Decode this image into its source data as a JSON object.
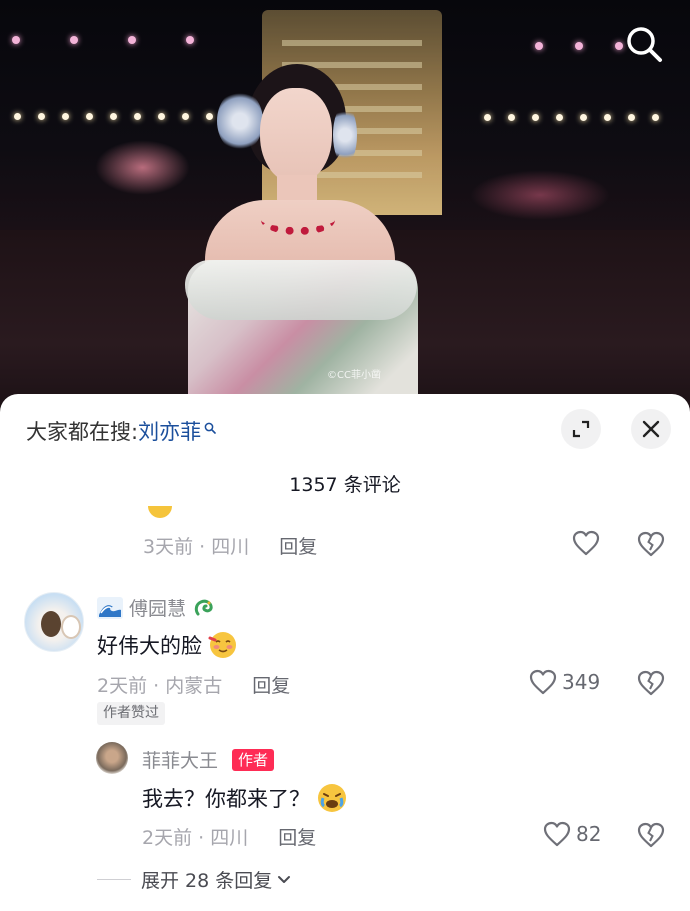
{
  "video": {
    "watermark": "©CC菲小凿"
  },
  "sheet": {
    "hot_search_prefix": "大家都在搜:",
    "hot_search_keyword": "刘亦菲",
    "comment_count_label": "1357 条评论"
  },
  "comments": [
    {
      "meta": "3天前 · 四川",
      "reply_label": "回复"
    },
    {
      "username": "傅园慧",
      "text": "好伟大的脸",
      "meta": "2天前 · 内蒙古",
      "reply_label": "回复",
      "likes": "349",
      "author_liked_badge": "作者赞过"
    },
    {
      "username": "菲菲大王",
      "author_tag": "作者",
      "text": "我去？你都来了？",
      "meta": "2天前 · 四川",
      "reply_label": "回复",
      "likes": "82"
    }
  ],
  "expand_replies_label": "展开 28 条回复",
  "icons": {
    "search": "search-icon",
    "expand": "expand-icon",
    "close": "close-icon",
    "like": "heart-icon",
    "dislike": "broken-heart-icon",
    "chevron": "chevron-down-icon"
  }
}
